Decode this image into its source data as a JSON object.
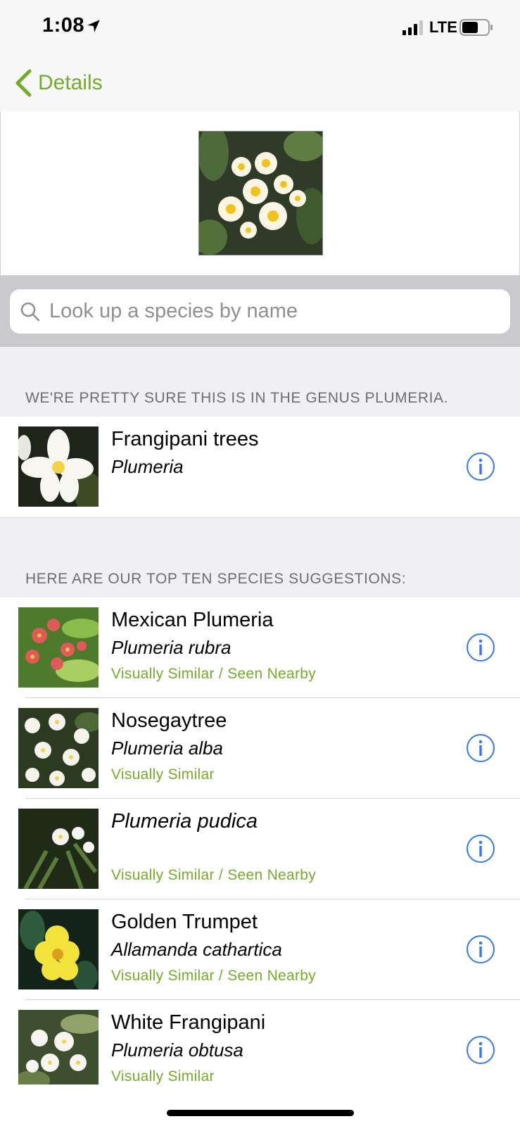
{
  "status_bar": {
    "time": "1:08",
    "network": "LTE",
    "icons": [
      "location-arrow-icon",
      "signal-bars-icon",
      "battery-icon"
    ]
  },
  "nav": {
    "back_label": "Details",
    "accent_color": "#74ac2a"
  },
  "search": {
    "placeholder": "Look up a species by name",
    "value": ""
  },
  "genus_section": {
    "header": "WE'RE PRETTY SURE THIS IS IN THE GENUS PLUMERIA.",
    "item": {
      "common_name": "Frangipani trees",
      "scientific_name": "Plumeria"
    }
  },
  "suggestions_section": {
    "header": "HERE ARE OUR TOP TEN SPECIES SUGGESTIONS:",
    "items": [
      {
        "common_name": "Mexican Plumeria",
        "scientific_name": "Plumeria rubra",
        "tag": "Visually Similar / Seen Nearby"
      },
      {
        "common_name": "Nosegaytree",
        "scientific_name": "Plumeria alba",
        "tag": "Visually Similar"
      },
      {
        "common_name": "Plumeria pudica",
        "scientific_name": "",
        "tag": "Visually Similar / Seen Nearby"
      },
      {
        "common_name": "Golden Trumpet",
        "scientific_name": "Allamanda cathartica",
        "tag": "Visually Similar / Seen Nearby"
      },
      {
        "common_name": "White Frangipani",
        "scientific_name": "Plumeria obtusa",
        "tag": "Visually Similar"
      }
    ]
  },
  "colors": {
    "info_icon": "#3478f6",
    "tag_text": "#74ac2a",
    "section_bg": "#efeff4"
  }
}
